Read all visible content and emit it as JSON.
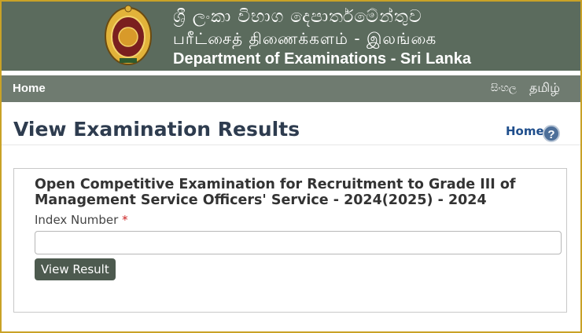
{
  "header": {
    "sinhala_name": "ශ්‍රී ලංකා විභාග දෙපාර්තමේන්තුව",
    "tamil_name": "பரீட்சைத் திணைக்களம் - இலங்கை",
    "english_name": "Department of Examinations - Sri Lanka"
  },
  "nav": {
    "home": "Home",
    "lang_sinhala": "සිංහල",
    "lang_tamil": "தமிழ்"
  },
  "page": {
    "title": "View Examination Results",
    "breadcrumb_home": "Home",
    "help_icon": "help-icon"
  },
  "form": {
    "exam_title": "Open Competitive Examination for Recruitment to Grade III of Management Service Officers' Service - 2024(2025) - 2024",
    "index_label": "Index Number",
    "required_mark": "*",
    "index_value": "",
    "submit_label": "View Result"
  },
  "colors": {
    "banner": "#5b6b5d",
    "nav": "#6f7b70",
    "button": "#4d5a4f",
    "border": "#c9a227"
  }
}
